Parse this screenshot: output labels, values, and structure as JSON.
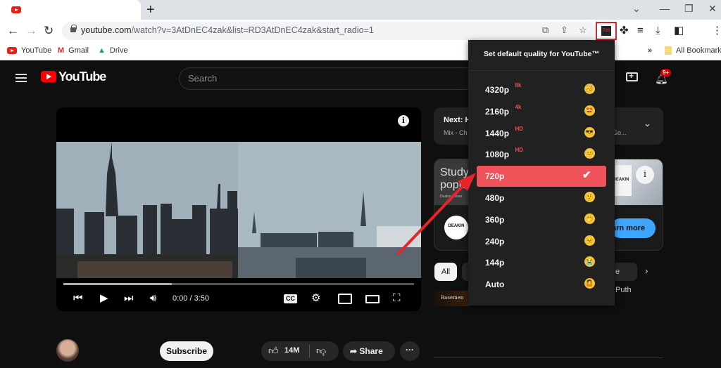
{
  "browser": {
    "new_tab_label": "+",
    "url_domain": "youtube.com",
    "url_rest": "/watch?v=3AtDnEC4zak&list=RD3AtDnEC4zak&start_radio=1",
    "extension_badge": "720",
    "bookmarks": [
      {
        "label": "YouTube",
        "icon": "youtube-icon"
      },
      {
        "label": "Gmail",
        "icon": "gmail-icon"
      },
      {
        "label": "Drive",
        "icon": "drive-icon"
      }
    ],
    "bookmarks_overflow": "»",
    "all_bookmarks": "All Bookmarks"
  },
  "youtube": {
    "logo_text": "YouTube",
    "search_placeholder": "Search",
    "notification_badge": "9+"
  },
  "player": {
    "time": "0:00 / 3:50",
    "progress_buffered_fraction": 0.31
  },
  "up_next": {
    "title": "Next: H",
    "subtitle": "Mix - Ch",
    "subtitle_tail": "Go..."
  },
  "ad": {
    "headline_1": "Study",
    "headline_2": "popu",
    "sub": "Deakin Univer",
    "brand": "DEAKIN",
    "brand_sub": "UNIVERSITY",
    "cta": "arn more"
  },
  "chips": {
    "all": "All",
    "puth": "e Puth"
  },
  "thumb_text": "Basemen",
  "actions": {
    "subscribe": "Subscribe",
    "likes": "14M",
    "share": "Share",
    "more": "···"
  },
  "popup": {
    "title": "Set default quality for YouTube™",
    "selected": "720p",
    "options": [
      {
        "label": "4320p",
        "tag": "8k",
        "emoji": "🥳"
      },
      {
        "label": "2160p",
        "tag": "4k",
        "emoji": "🤩"
      },
      {
        "label": "1440p",
        "tag": "HD",
        "emoji": "😎"
      },
      {
        "label": "1080p",
        "tag": "HD",
        "emoji": "😊"
      },
      {
        "label": "720p",
        "tag": "",
        "emoji": "✔"
      },
      {
        "label": "480p",
        "tag": "",
        "emoji": "🤨"
      },
      {
        "label": "360p",
        "tag": "",
        "emoji": "🤭"
      },
      {
        "label": "240p",
        "tag": "",
        "emoji": "😣"
      },
      {
        "label": "144p",
        "tag": "",
        "emoji": "😭"
      },
      {
        "label": "Auto",
        "tag": "",
        "emoji": "🤷"
      }
    ]
  }
}
